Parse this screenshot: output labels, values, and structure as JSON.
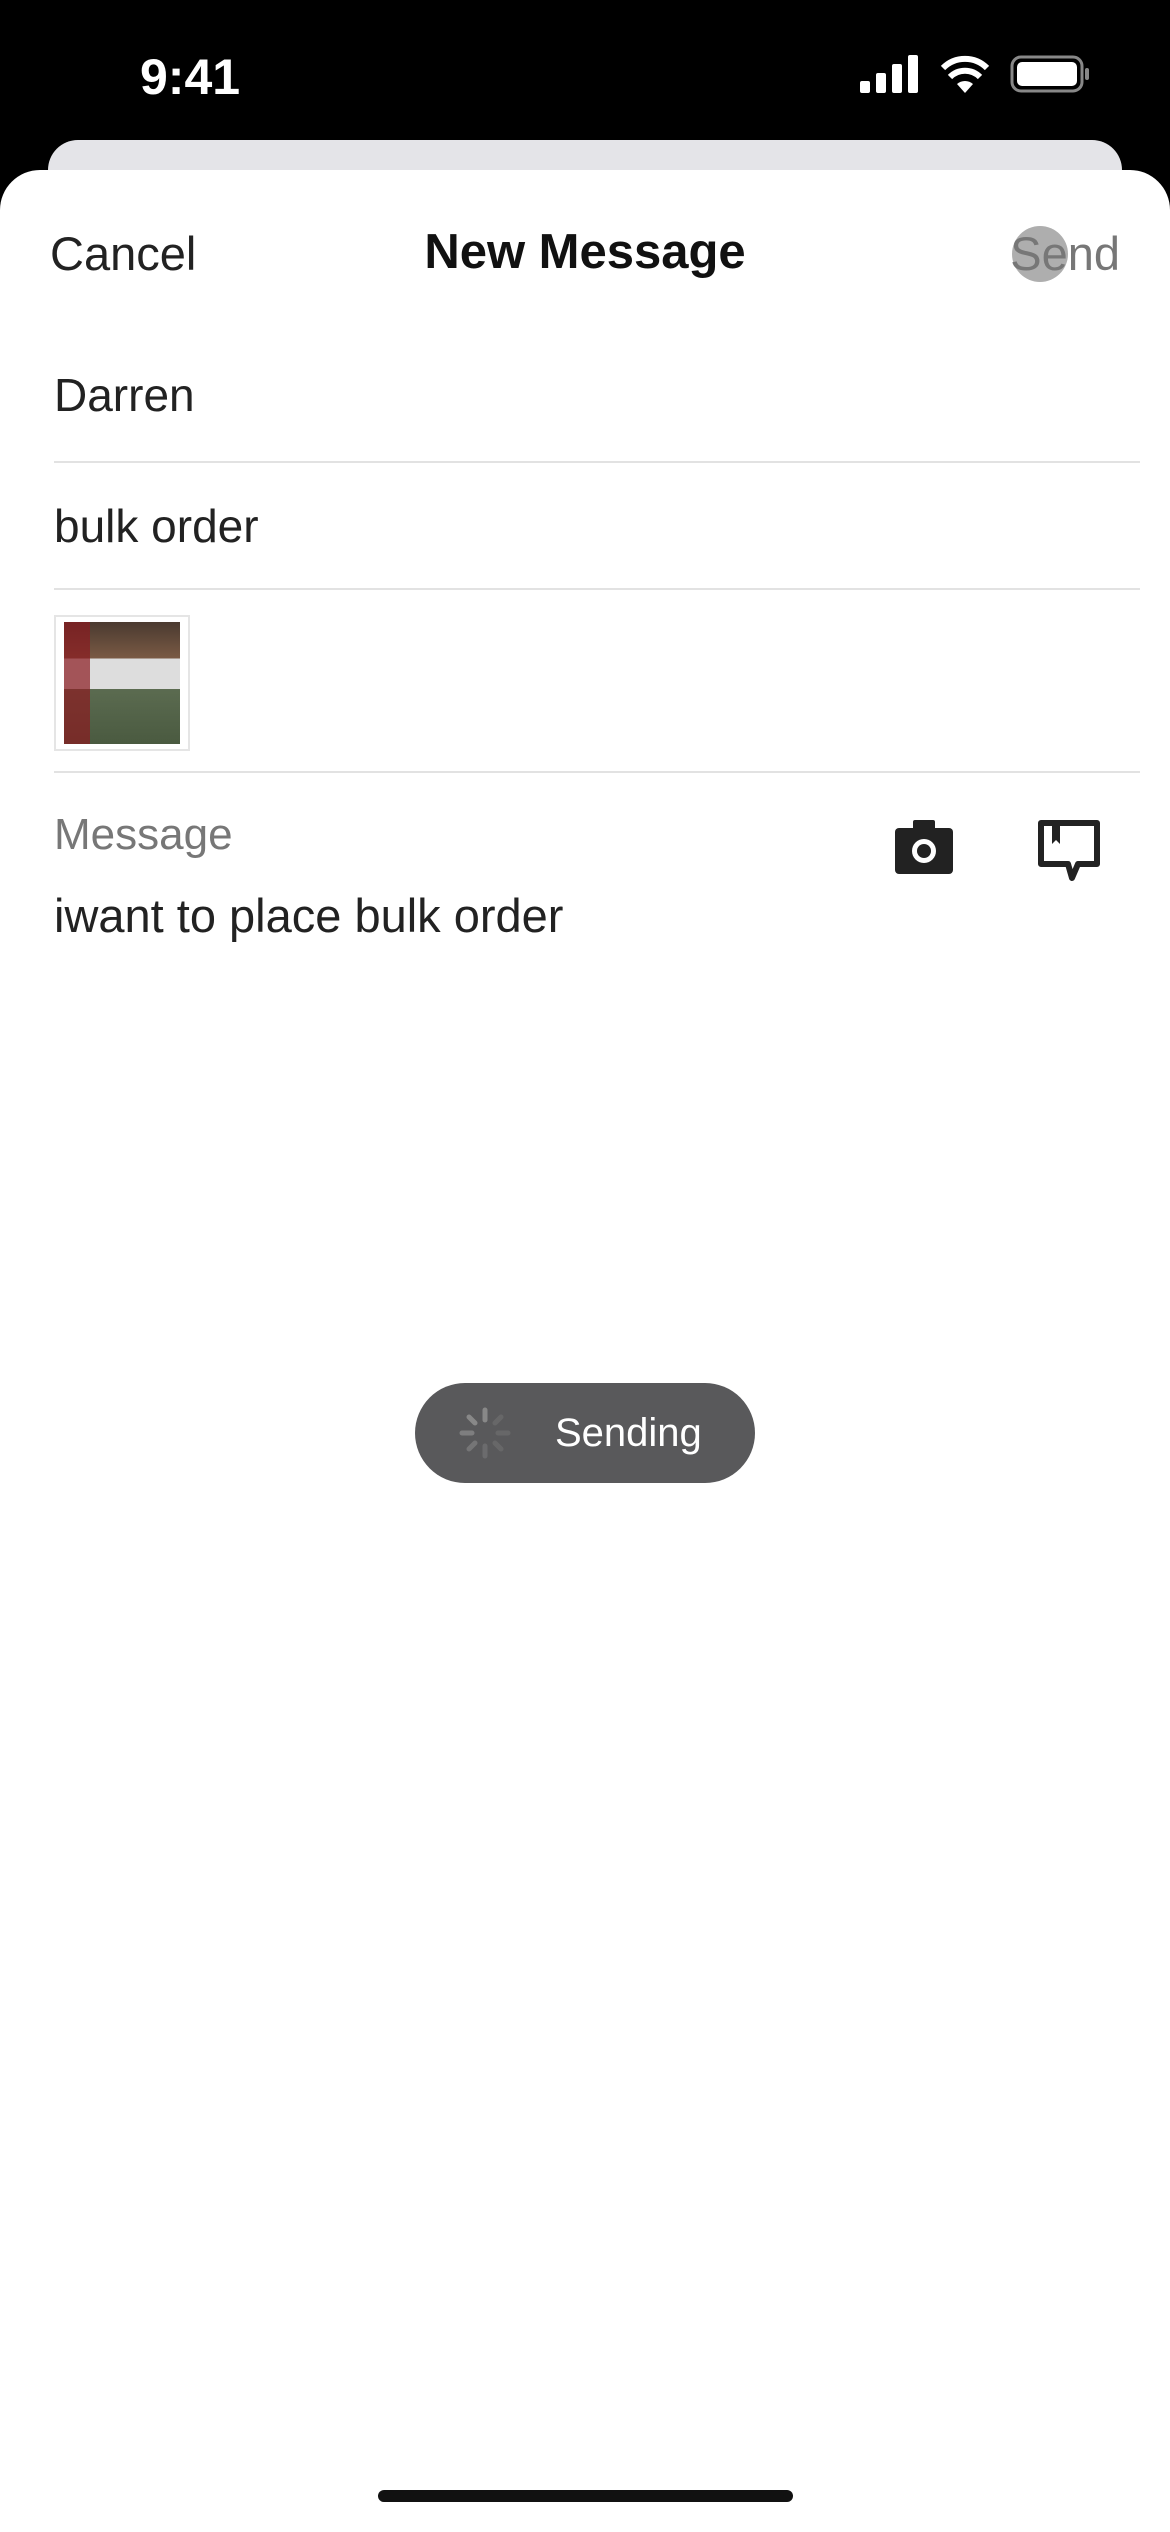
{
  "status_bar": {
    "time": "9:41",
    "icons": [
      "cellular-signal-icon",
      "wifi-icon",
      "battery-icon"
    ]
  },
  "nav": {
    "cancel_label": "Cancel",
    "title": "New Message",
    "send_label": "Send"
  },
  "form": {
    "recipient": "Darren",
    "subject": "bulk order",
    "message_placeholder": "Message",
    "message_value": "iwant to place bulk order"
  },
  "attachment": {
    "icon": "product-thumbnail"
  },
  "toolbar": {
    "icons": [
      "camera-icon",
      "saved-replies-icon"
    ]
  },
  "toast": {
    "label": "Sending"
  }
}
